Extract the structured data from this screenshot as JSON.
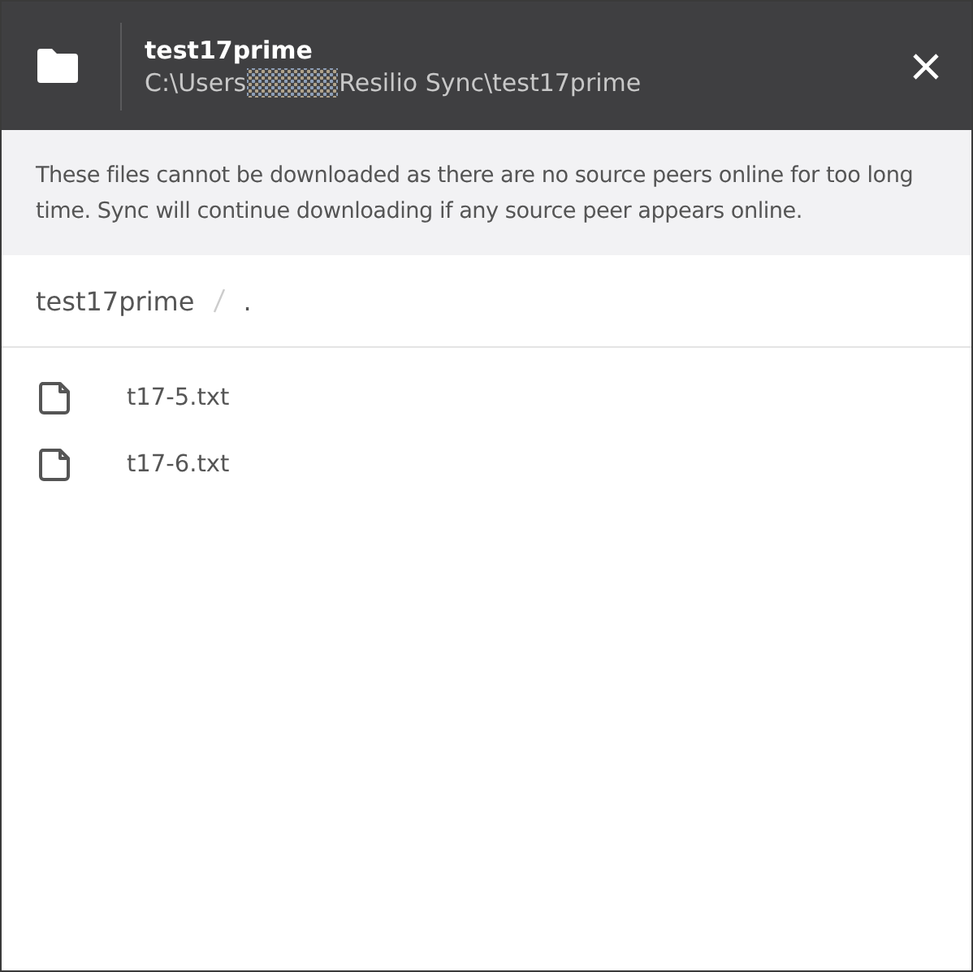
{
  "header": {
    "title": "test17prime",
    "path_start": "C:\\Users",
    "path_end": "Resilio Sync\\test17prime"
  },
  "notice": "These files cannot be downloaded as there are no source peers online for too long time. Sync will continue downloading if any source peer appears online.",
  "breadcrumb": [
    {
      "label": "test17prime"
    },
    {
      "label": "."
    }
  ],
  "files": [
    {
      "name": "t17-5.txt"
    },
    {
      "name": "t17-6.txt"
    }
  ]
}
